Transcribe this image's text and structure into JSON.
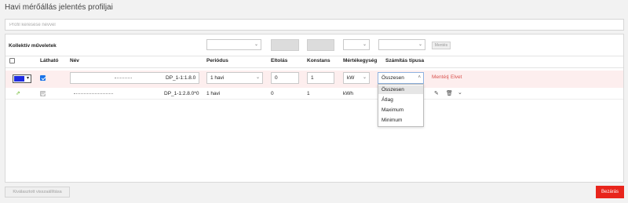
{
  "page": {
    "title": "Havi mérőállás jelentés profiljai",
    "search_placeholder": "Profil keresése névvel"
  },
  "bulk": {
    "label": "Kollektív műveletek",
    "save_label": "Mentés"
  },
  "columns": {
    "visible": "Látható",
    "name": "Név",
    "period": "Periódus",
    "offset": "Eltolás",
    "constant": "Konstans",
    "unit": "Mértékegység",
    "calc_type": "Számítás típusa"
  },
  "edit_row": {
    "color": "#1f2be0",
    "name_value": "DP_1-1:1.8.0",
    "period": "1 havi",
    "offset": "0",
    "constant": "1",
    "unit": "kW",
    "calc_type": "Összesen",
    "save_link": "Mentés",
    "separator": "|",
    "cancel_link": "Elvet"
  },
  "data_row": {
    "name_value": "DP_1-1:2.8.0*0",
    "period": "1 havi",
    "offset": "0",
    "constant": "1",
    "unit": "kWh",
    "calc_type": "Összesen"
  },
  "dropdown_options": [
    "Összesen",
    "Átlag",
    "Maximum",
    "Minimum"
  ],
  "footer": {
    "reset_label": "Kiválasztott visszaállítása",
    "close_label": "Bezárás"
  }
}
